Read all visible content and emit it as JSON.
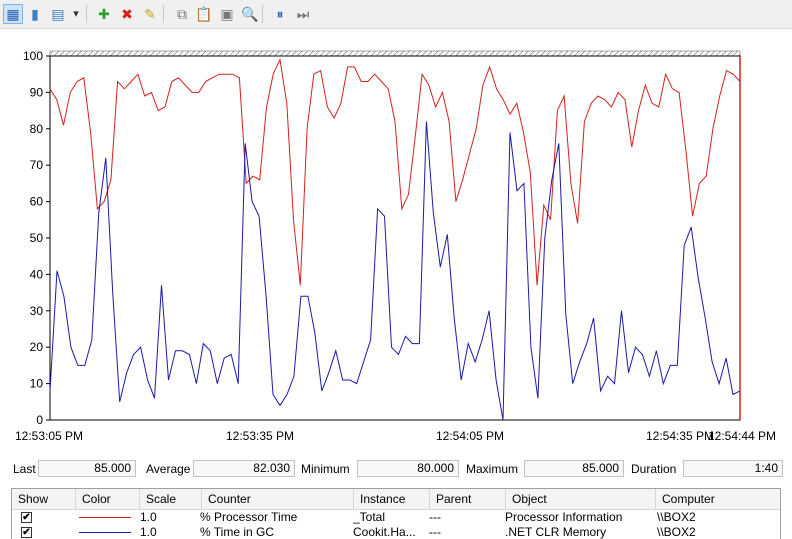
{
  "toolbar": {
    "buttons": [
      {
        "name": "view-graph-icon",
        "glyph": "▦",
        "color": "#2a62b8",
        "active": true
      },
      {
        "name": "view-histogram-icon",
        "glyph": "▮",
        "color": "#3b7fc4",
        "active": false
      },
      {
        "name": "change-graph-type-icon",
        "glyph": "▤",
        "color": "#3b7fc4",
        "active": false
      },
      {
        "name": "dropdown-arrow-icon",
        "glyph": "▾",
        "color": "#333333",
        "active": false
      },
      {
        "name": "add-counter-icon",
        "glyph": "✚",
        "color": "#2ca02c",
        "active": false
      },
      {
        "name": "delete-counter-icon",
        "glyph": "✖",
        "color": "#d62020",
        "active": false
      },
      {
        "name": "highlight-icon",
        "glyph": "✎",
        "color": "#c9a21a",
        "active": false
      },
      {
        "name": "copy-properties-icon",
        "glyph": "⧉",
        "color": "#777777",
        "active": false
      },
      {
        "name": "paste-counter-list-icon",
        "glyph": "📋",
        "color": "#777777",
        "active": false
      },
      {
        "name": "properties-icon",
        "glyph": "▣",
        "color": "#777777",
        "active": false
      },
      {
        "name": "zoom-icon",
        "glyph": "🔍",
        "color": "#777777",
        "active": false
      },
      {
        "name": "freeze-display-icon",
        "glyph": "⏸",
        "color": "#2a62b8",
        "active": false
      },
      {
        "name": "update-data-icon",
        "glyph": "⏭",
        "color": "#777777",
        "active": false
      }
    ]
  },
  "chart_data": {
    "type": "line",
    "ylim": [
      0,
      100
    ],
    "yticks": [
      0,
      10,
      20,
      30,
      40,
      50,
      60,
      70,
      80,
      90,
      100
    ],
    "xlabels": [
      "12:53:05 PM",
      "12:53:35 PM",
      "12:54:05 PM",
      "12:54:35 PM",
      "12:54:44 PM"
    ],
    "grid": false,
    "series": [
      {
        "name": "% Processor Time",
        "color": "#d42020",
        "values": [
          91,
          88,
          81,
          90,
          93,
          94,
          79,
          58,
          60,
          66,
          93,
          91,
          93,
          95,
          89,
          90,
          85,
          86,
          93,
          94,
          92,
          90,
          90,
          93,
          94,
          95,
          95,
          95,
          94,
          65,
          67,
          66,
          86,
          95,
          99,
          87,
          55,
          37,
          80,
          95,
          96,
          86,
          83,
          87,
          97,
          97,
          93,
          93,
          95,
          93,
          91,
          82,
          58,
          62,
          78,
          95,
          92,
          86,
          90,
          82,
          60,
          66,
          73,
          80,
          92,
          97,
          91,
          88,
          84,
          87,
          79,
          68,
          37,
          59,
          55,
          85,
          89,
          65,
          54,
          82,
          87,
          89,
          88,
          86,
          90,
          88,
          75,
          85,
          92,
          87,
          86,
          95,
          91,
          90,
          74,
          56,
          65,
          67,
          80,
          89,
          96,
          95,
          93
        ]
      },
      {
        "name": "% Time in GC",
        "color": "#1a1aa8",
        "values": [
          8,
          41,
          34,
          20,
          15,
          15,
          22,
          57,
          72,
          35,
          5,
          13,
          18,
          20,
          11,
          6,
          37,
          11,
          19,
          19,
          18,
          10,
          21,
          19,
          10,
          17,
          18,
          10,
          76,
          60,
          56,
          34,
          7,
          4,
          7,
          12,
          34,
          34,
          24,
          8,
          13,
          19,
          11,
          11,
          10,
          16,
          22,
          58,
          56,
          20,
          18,
          23,
          21,
          21,
          82,
          57,
          42,
          51,
          28,
          11,
          21,
          16,
          22,
          30,
          11,
          0,
          79,
          63,
          65,
          20,
          6,
          50,
          66,
          76,
          29,
          10,
          16,
          21,
          28,
          8,
          12,
          10,
          30,
          13,
          20,
          18,
          12,
          19,
          10,
          15,
          15,
          48,
          53,
          39,
          28,
          16,
          10,
          17,
          7,
          8
        ]
      }
    ]
  },
  "stats": {
    "last_label": "Last",
    "last_value": "85.000",
    "average_label": "Average",
    "average_value": "82.030",
    "minimum_label": "Minimum",
    "minimum_value": "80.000",
    "maximum_label": "Maximum",
    "maximum_value": "85.000",
    "duration_label": "Duration",
    "duration_value": "1:40"
  },
  "legend": {
    "headers": {
      "show": "Show",
      "color": "Color",
      "scale": "Scale",
      "counter": "Counter",
      "instance": "Instance",
      "parent": "Parent",
      "object": "Object",
      "computer": "Computer"
    },
    "rows": [
      {
        "checked": "✔",
        "color": "#d42020",
        "scale": "1.0",
        "counter": "% Processor Time",
        "instance": "_Total",
        "parent": "---",
        "object": "Processor Information",
        "computer": "\\\\BOX2"
      },
      {
        "checked": "✔",
        "color": "#1a1aa8",
        "scale": "1.0",
        "counter": "% Time in GC",
        "instance": "Cookit.Ha...",
        "parent": "---",
        "object": ".NET CLR Memory",
        "computer": "\\\\BOX2"
      }
    ]
  }
}
